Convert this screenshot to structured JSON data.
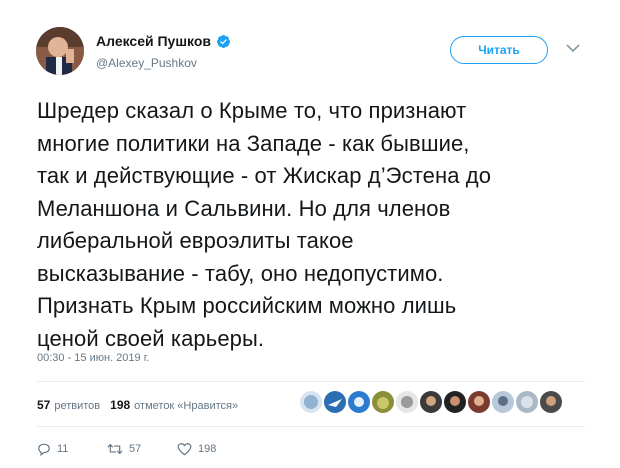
{
  "author": {
    "name": "Алексей Пушков",
    "handle": "@Alexey_Pushkov",
    "verified_color": "#1da1f2"
  },
  "follow_button": {
    "label": "Читать"
  },
  "tweet": {
    "lines": [
      "Шредер сказал о Крыме то, что признают",
      "многие политики на Западе - как бывшие,",
      "так и действующие - от Жискар д’Эстена до",
      "Меланшона и Сальвини. Но для членов",
      "либеральной евроэлиты такое",
      "высказывание - табу, оно недопустимо.",
      "Признать Крым российским можно лишь",
      "ценой своей карьеры."
    ],
    "timestamp": "00:30 - 15 июн. 2019 г."
  },
  "stats": {
    "retweets_count": "57",
    "retweets_label": "ретвитов",
    "likes_count": "198",
    "likes_label": "отметок «Нравится»"
  },
  "actions": {
    "replies": "11",
    "retweets": "57",
    "likes": "198"
  },
  "icons": [
    "verified-badge-icon",
    "chevron-down-icon",
    "reply-icon",
    "retweet-icon",
    "heart-icon"
  ],
  "colors": {
    "accent": "#1da1f2",
    "muted": "#657786",
    "text": "#14171a",
    "border": "#e6ecf0"
  }
}
